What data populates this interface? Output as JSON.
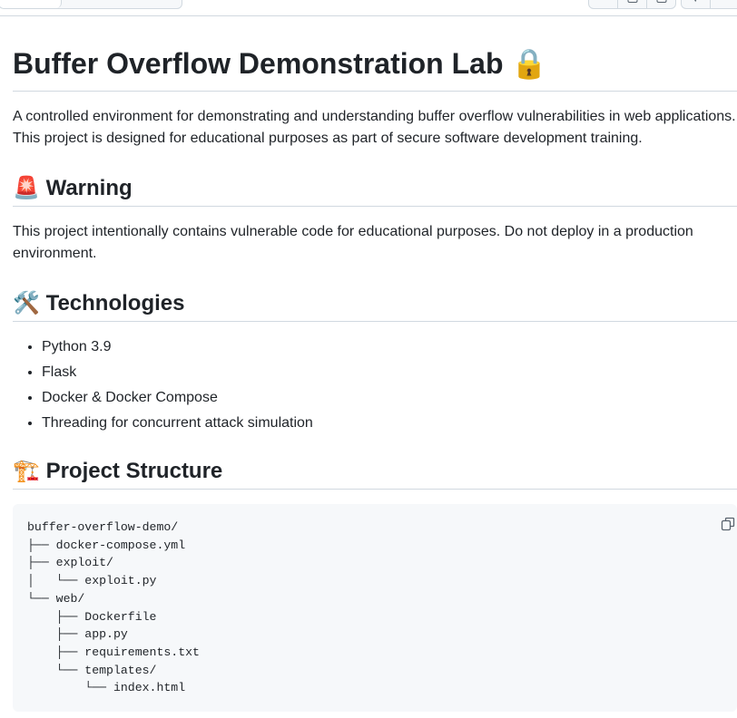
{
  "readme": {
    "title": "Buffer Overflow Demonstration Lab",
    "title_emoji": "🔒",
    "intro": "A controlled environment for demonstrating and understanding buffer overflow vulnerabilities in web applications. This project is designed for educational purposes as part of secure software development training.",
    "warning": {
      "emoji": "🚨",
      "heading": "Warning",
      "text": "This project intentionally contains vulnerable code for educational purposes. Do not deploy in a production environment."
    },
    "technologies": {
      "emoji": "🛠️",
      "heading": "Technologies",
      "items": [
        "Python 3.9",
        "Flask",
        "Docker & Docker Compose",
        "Threading for concurrent attack simulation"
      ]
    },
    "structure": {
      "emoji": "🏗️",
      "heading": "Project Structure",
      "code": "buffer-overflow-demo/\n├── docker-compose.yml\n├── exploit/\n│   └── exploit.py\n└── web/\n    ├── Dockerfile\n    ├── app.py\n    ├── requirements.txt\n    └── templates/\n        └── index.html"
    }
  }
}
